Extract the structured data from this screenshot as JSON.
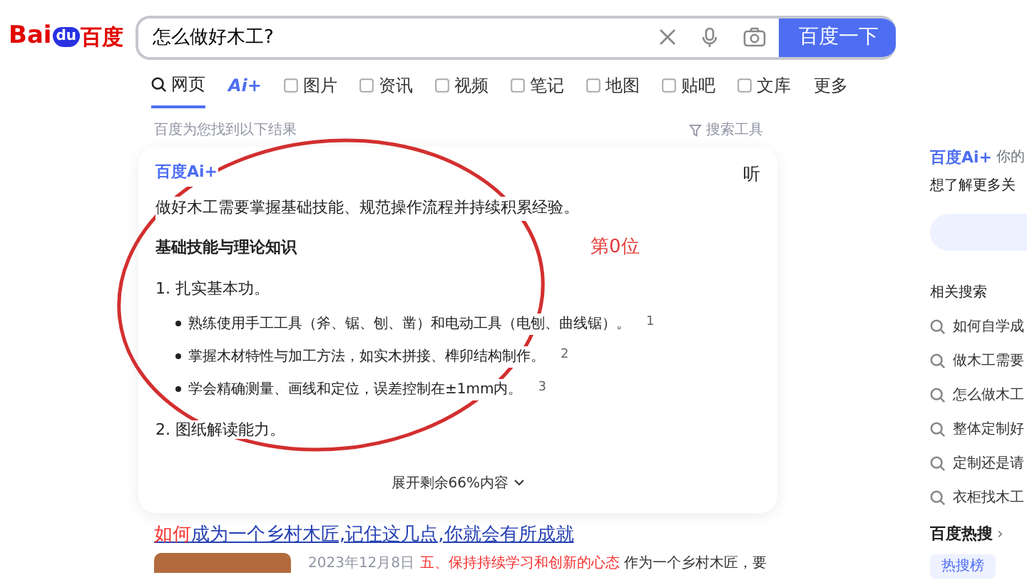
{
  "header": {
    "logo": {
      "latin_a": "Bai",
      "paw": "du",
      "chinese": "百度"
    },
    "query": "怎么做好木工?",
    "search_button": "百度一下"
  },
  "tabs": [
    {
      "label": "网页",
      "kind": "search",
      "selected": true
    },
    {
      "label": "Ai+",
      "kind": "ai",
      "selected": false
    },
    {
      "label": "图片",
      "kind": "icon",
      "selected": false
    },
    {
      "label": "资讯",
      "kind": "icon",
      "selected": false
    },
    {
      "label": "视频",
      "kind": "icon",
      "selected": false
    },
    {
      "label": "笔记",
      "kind": "icon",
      "selected": false
    },
    {
      "label": "地图",
      "kind": "icon",
      "selected": false
    },
    {
      "label": "贴吧",
      "kind": "icon",
      "selected": false
    },
    {
      "label": "文库",
      "kind": "icon",
      "selected": false
    },
    {
      "label": "更多",
      "kind": "plain",
      "selected": false
    }
  ],
  "result_info": "百度为您找到以下结果",
  "search_tools": "搜索工具",
  "ai_card": {
    "brand": "百度Ai+",
    "listen": "听",
    "summary": "做好木工需要掌握基础技能、规范操作流程并持续积累经验。",
    "heading": "基础技能与理论知识",
    "sections": [
      {
        "title": "1. 扎实基本功。",
        "items": [
          {
            "text": "熟练使用手工工具（斧、锯、刨、凿）和电动工具（电刨、曲线锯）。",
            "ref": "1"
          },
          {
            "text": "掌握木材特性与加工方法，如实木拼接、榫卯结构制作。",
            "ref": "2"
          },
          {
            "text": "学会精确测量、画线和定位，误差控制在±1mm内。",
            "ref": "3"
          }
        ]
      },
      {
        "title": "2. 图纸解读能力。"
      }
    ],
    "expand": "展开剩余66%内容"
  },
  "annotation": "第0位",
  "result": {
    "title": "**如何**成为一个乡村木匠,记住这几点,你就会有所成就",
    "date": "2023年12月8日",
    "snippet": "**五、保持持续学习和创新的心态** 作为一个乡村木匠，要"
  },
  "sidebar": {
    "ai_brand": "百度Ai+",
    "ai_hint": "你的",
    "ai_prompt": "想了解更多关",
    "related_title": "相关搜索",
    "related": [
      "如何自学成",
      "做木工需要",
      "怎么做木工",
      "整体定制好",
      "定制还是请",
      "衣柜找木工"
    ],
    "hot_title": "百度热搜",
    "hot_arrow": "›",
    "hot_tab": "热搜榜"
  }
}
